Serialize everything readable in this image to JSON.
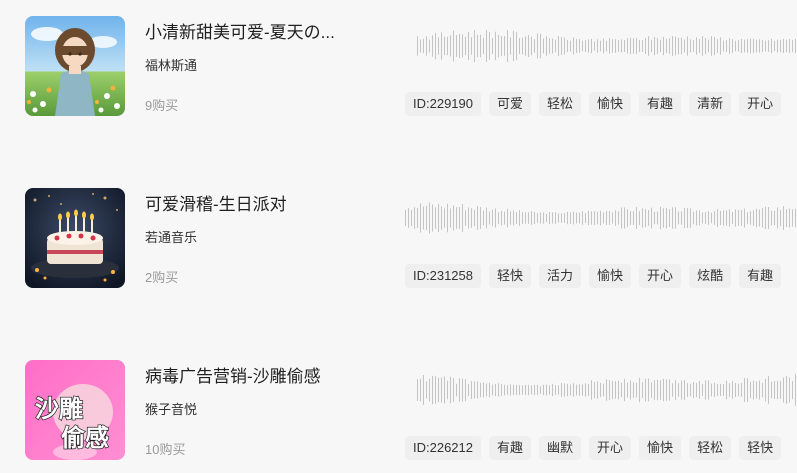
{
  "tracks": [
    {
      "title": "小清新甜美可爱-夏天の...",
      "artist": "福林斯通",
      "purchases": "9购买",
      "id_label": "ID:229190",
      "tags": [
        "可爱",
        "轻松",
        "愉快",
        "有趣",
        "清新",
        "开心"
      ],
      "cover_icon": "anime-girl-flower-field",
      "waveform_seed": 3
    },
    {
      "title": "可爱滑稽-生日派对",
      "artist": "若通音乐",
      "purchases": "2购买",
      "id_label": "ID:231258",
      "tags": [
        "轻快",
        "活力",
        "愉快",
        "开心",
        "炫酷",
        "有趣"
      ],
      "cover_icon": "birthday-cake-candles",
      "waveform_seed": 7
    },
    {
      "title": "病毒广告营销-沙雕偷感",
      "artist": "猴子音悦",
      "purchases": "10购买",
      "id_label": "ID:226212",
      "tags": [
        "有趣",
        "幽默",
        "开心",
        "愉快",
        "轻松",
        "轻快"
      ],
      "cover_icon": "pink-meme-cover",
      "cover_text": [
        "沙雕",
        "偷感"
      ],
      "waveform_seed": 11
    }
  ],
  "colors": {
    "background": "#f7f7f7",
    "tag_background": "#efefef",
    "waveform": "#c4c4c4",
    "muted_text": "#9a9a9a"
  }
}
